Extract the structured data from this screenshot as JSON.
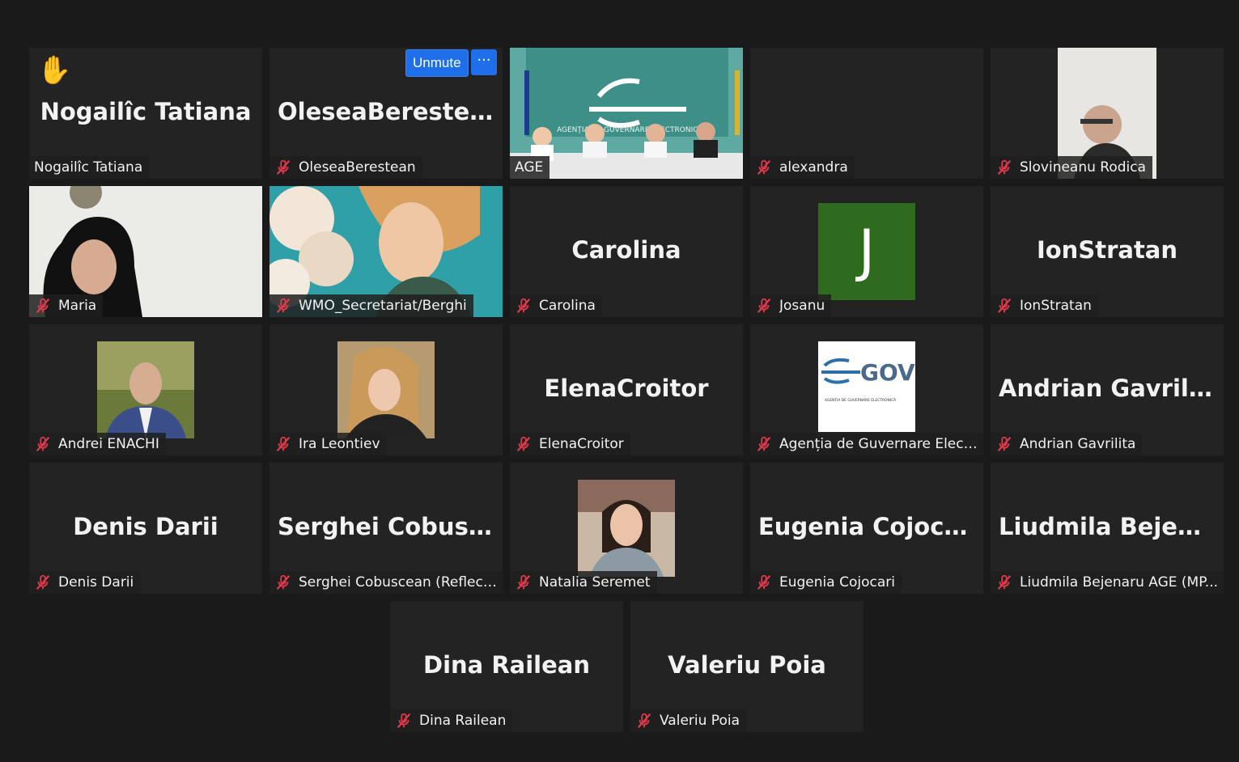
{
  "controls": {
    "unmute_label": "Unmute",
    "more_label": "···"
  },
  "tiles": [
    {
      "big": "Nogailîc Tatiana",
      "label": "Nogailîc Tatiana"
    },
    {
      "big": "OleseaBerestean",
      "label": "OleseaBerestean"
    },
    {
      "big": "",
      "label": "AGE"
    },
    {
      "big": "",
      "label": "alexandra"
    },
    {
      "big": "",
      "label": "Slovineanu Rodica"
    },
    {
      "big": "",
      "label": "Maria"
    },
    {
      "big": "",
      "label": "WMO_Secretariat/Berghi"
    },
    {
      "big": "Carolina",
      "label": "Carolina"
    },
    {
      "big": "J",
      "label": "Josanu"
    },
    {
      "big": "IonStratan",
      "label": "IonStratan"
    },
    {
      "big": "",
      "label": "Andrei ENACHI"
    },
    {
      "big": "",
      "label": "Ira Leontiev"
    },
    {
      "big": "ElenaCroitor",
      "label": "ElenaCroitor"
    },
    {
      "big": "GOV",
      "label": "Agenția de Guvernare Electr..."
    },
    {
      "big": "Andrian Gavrilita",
      "label": "Andrian Gavrilita"
    },
    {
      "big": "Denis Darii",
      "label": "Denis Darii"
    },
    {
      "big": "Serghei  Cobusc...",
      "label": "Serghei Cobuscean (Reflecta..."
    },
    {
      "big": "",
      "label": "Natalia Seremet"
    },
    {
      "big": "Eugenia Cojocari",
      "label": "Eugenia Cojocari"
    },
    {
      "big": "Liudmila  Bejena...",
      "label": "Liudmila Bejenaru AGE (MP..."
    },
    {
      "big": "Dina Railean",
      "label": "Dina Railean"
    },
    {
      "big": "Valeriu Poia",
      "label": "Valeriu Poia"
    }
  ],
  "age_banner": "AGENȚIA DE GUVERNARE ELECTRONICĂ",
  "gov_subtitle": "AGENȚIA DE GUVERNARE ELECTRONICĂ",
  "colors": {
    "speaking_border": "#d6e86a",
    "tile_bg": "#232323",
    "button_blue": "#1f6feb",
    "mic_red": "#e0394a"
  }
}
